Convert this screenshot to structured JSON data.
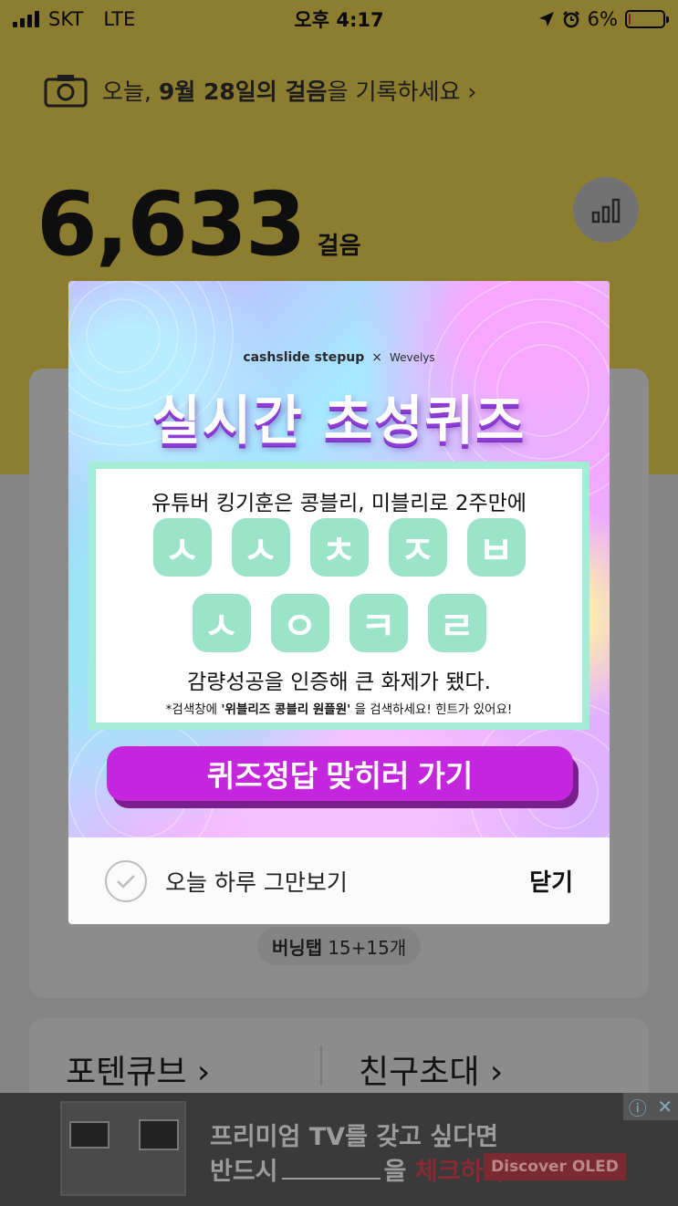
{
  "status_bar": {
    "carrier": "SKT",
    "network": "LTE",
    "time": "오후 4:17",
    "battery": "6%",
    "battery_level": 0.06
  },
  "header": {
    "record_prefix": "오늘, ",
    "record_bold": "9월 28일의 걸음",
    "record_suffix": "을 기록하세요",
    "chevron": "›"
  },
  "steps": {
    "count": "6,633",
    "unit": "걸음"
  },
  "burning_tap": {
    "label": "버닝탭",
    "value": "15+15개"
  },
  "bottom_links": [
    "포텐큐브 ›",
    "친구초대 ›"
  ],
  "popup": {
    "brand_left": "cashslide stepup",
    "brand_x": "×",
    "brand_right": "Wevelys",
    "title": "실시간 초성퀴즈",
    "question_top": "유튜버 킹기훈은 콩블리, 미블리로 2주만에",
    "jamo_row1": [
      "ㅅ",
      "ㅅ",
      "ㅊ",
      "ㅈ",
      "ㅂ"
    ],
    "jamo_row2": [
      "ㅅ",
      "ㅇ",
      "ㅋ",
      "ㄹ"
    ],
    "question_bottom": "감량성공을 인증해 큰 화제가 됐다.",
    "hint_prefix": "*검색창에 ",
    "hint_bold": "'위블리즈 콩블리 원플원'",
    "hint_suffix": " 을 검색하세요! 힌트가 있어요!",
    "cta": "퀴즈정답 맞히러 가기",
    "dont_show": "오늘 하루 그만보기",
    "close": "닫기"
  },
  "ad": {
    "line1": "프리미엄 TV를 갖고 싶다면",
    "line2_prefix": "반드시",
    "line2_mid": "을",
    "line2_red": "체크하라!",
    "cta": "Discover OLED",
    "info_icon": "ⓘ",
    "close_icon": "✕"
  },
  "colors": {
    "yellow": "#ffe35a",
    "mint": "#9be3c9",
    "magenta": "#c326dc",
    "title_shadow": "#8d3cd6"
  }
}
